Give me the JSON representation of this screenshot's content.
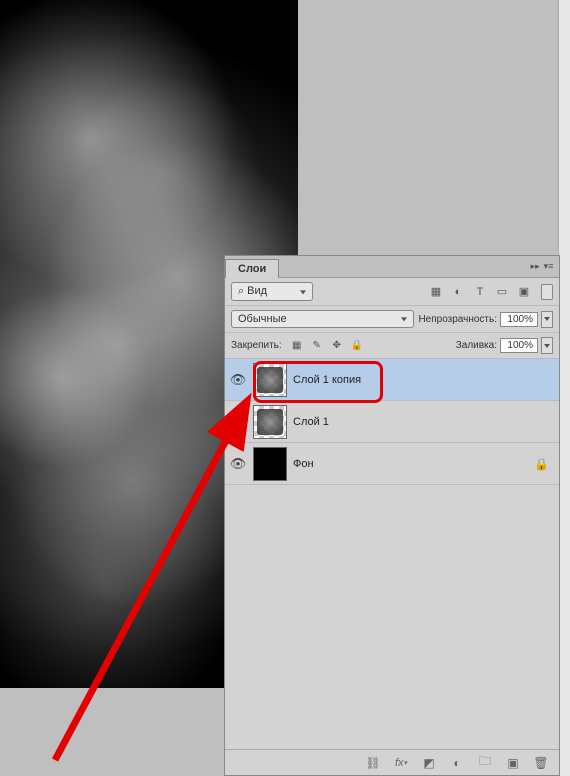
{
  "panel": {
    "tab_label": "Слои",
    "filter_label": "Вид",
    "blend_mode": "Обычные",
    "opacity_label": "Непрозрачность:",
    "opacity_value": "100%",
    "lock_label": "Закрепить:",
    "fill_label": "Заливка:",
    "fill_value": "100%"
  },
  "filter_icons": {
    "image": "image-icon",
    "adjust": "adjust-icon",
    "type": "type-icon",
    "shape": "shape-icon",
    "smart": "smart-icon"
  },
  "lock_icons": {
    "transparency": "checker",
    "brush": "brush",
    "move": "move",
    "all": "lock"
  },
  "layers": [
    {
      "name": "Слой 1 копия",
      "visible": true,
      "selected": true,
      "thumb": "clouds",
      "locked": false
    },
    {
      "name": "Слой 1",
      "visible": false,
      "selected": false,
      "thumb": "clouds",
      "locked": false
    },
    {
      "name": "Фон",
      "visible": true,
      "selected": false,
      "thumb": "solid-black",
      "locked": true
    }
  ],
  "footer_icons": {
    "link": "link",
    "fx": "fx",
    "mask": "mask",
    "adjust": "adjustment",
    "group": "group",
    "new": "new-layer",
    "delete": "trash"
  },
  "annotation": {
    "highlight_layer_index": 0,
    "arrow_target": "layer-visibility-1"
  }
}
